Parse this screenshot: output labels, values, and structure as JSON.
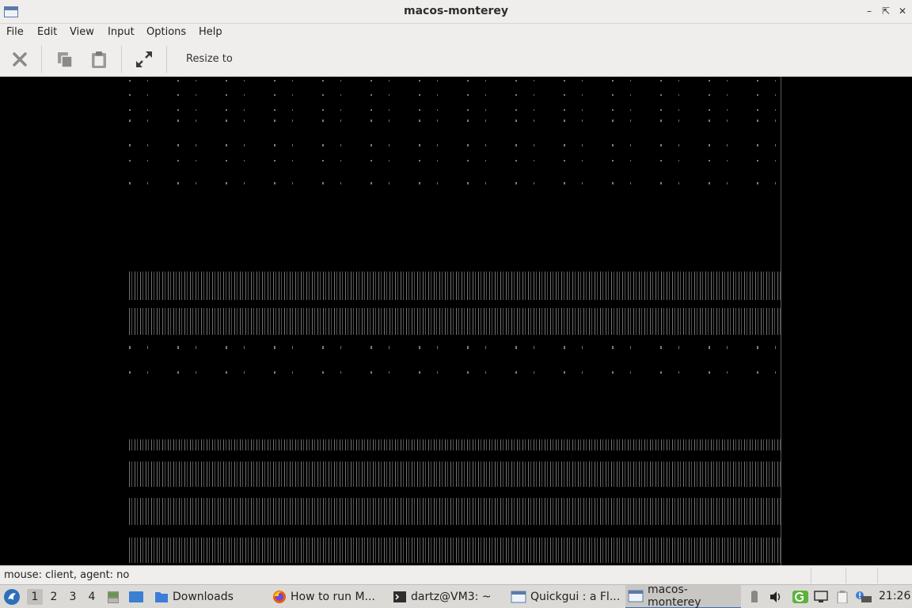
{
  "window": {
    "title": "macos-monterey"
  },
  "menu": [
    "File",
    "Edit",
    "View",
    "Input",
    "Options",
    "Help"
  ],
  "toolbar": {
    "resize_label": "Resize to"
  },
  "status": {
    "message": "mouse: client, agent:  no"
  },
  "taskbar": {
    "workspaces": [
      "1",
      "2",
      "3",
      "4"
    ],
    "tasks": [
      {
        "label": "Downloads",
        "icon": "folder-icon"
      },
      {
        "label": "How to run M...",
        "icon": "firefox-icon"
      },
      {
        "label": "dartz@VM3: ~",
        "icon": "terminal-icon"
      },
      {
        "label": "Quickgui : a Fl...",
        "icon": "window-icon"
      },
      {
        "label": "macos-monterey",
        "icon": "window-icon"
      }
    ],
    "clock": "21:26"
  }
}
